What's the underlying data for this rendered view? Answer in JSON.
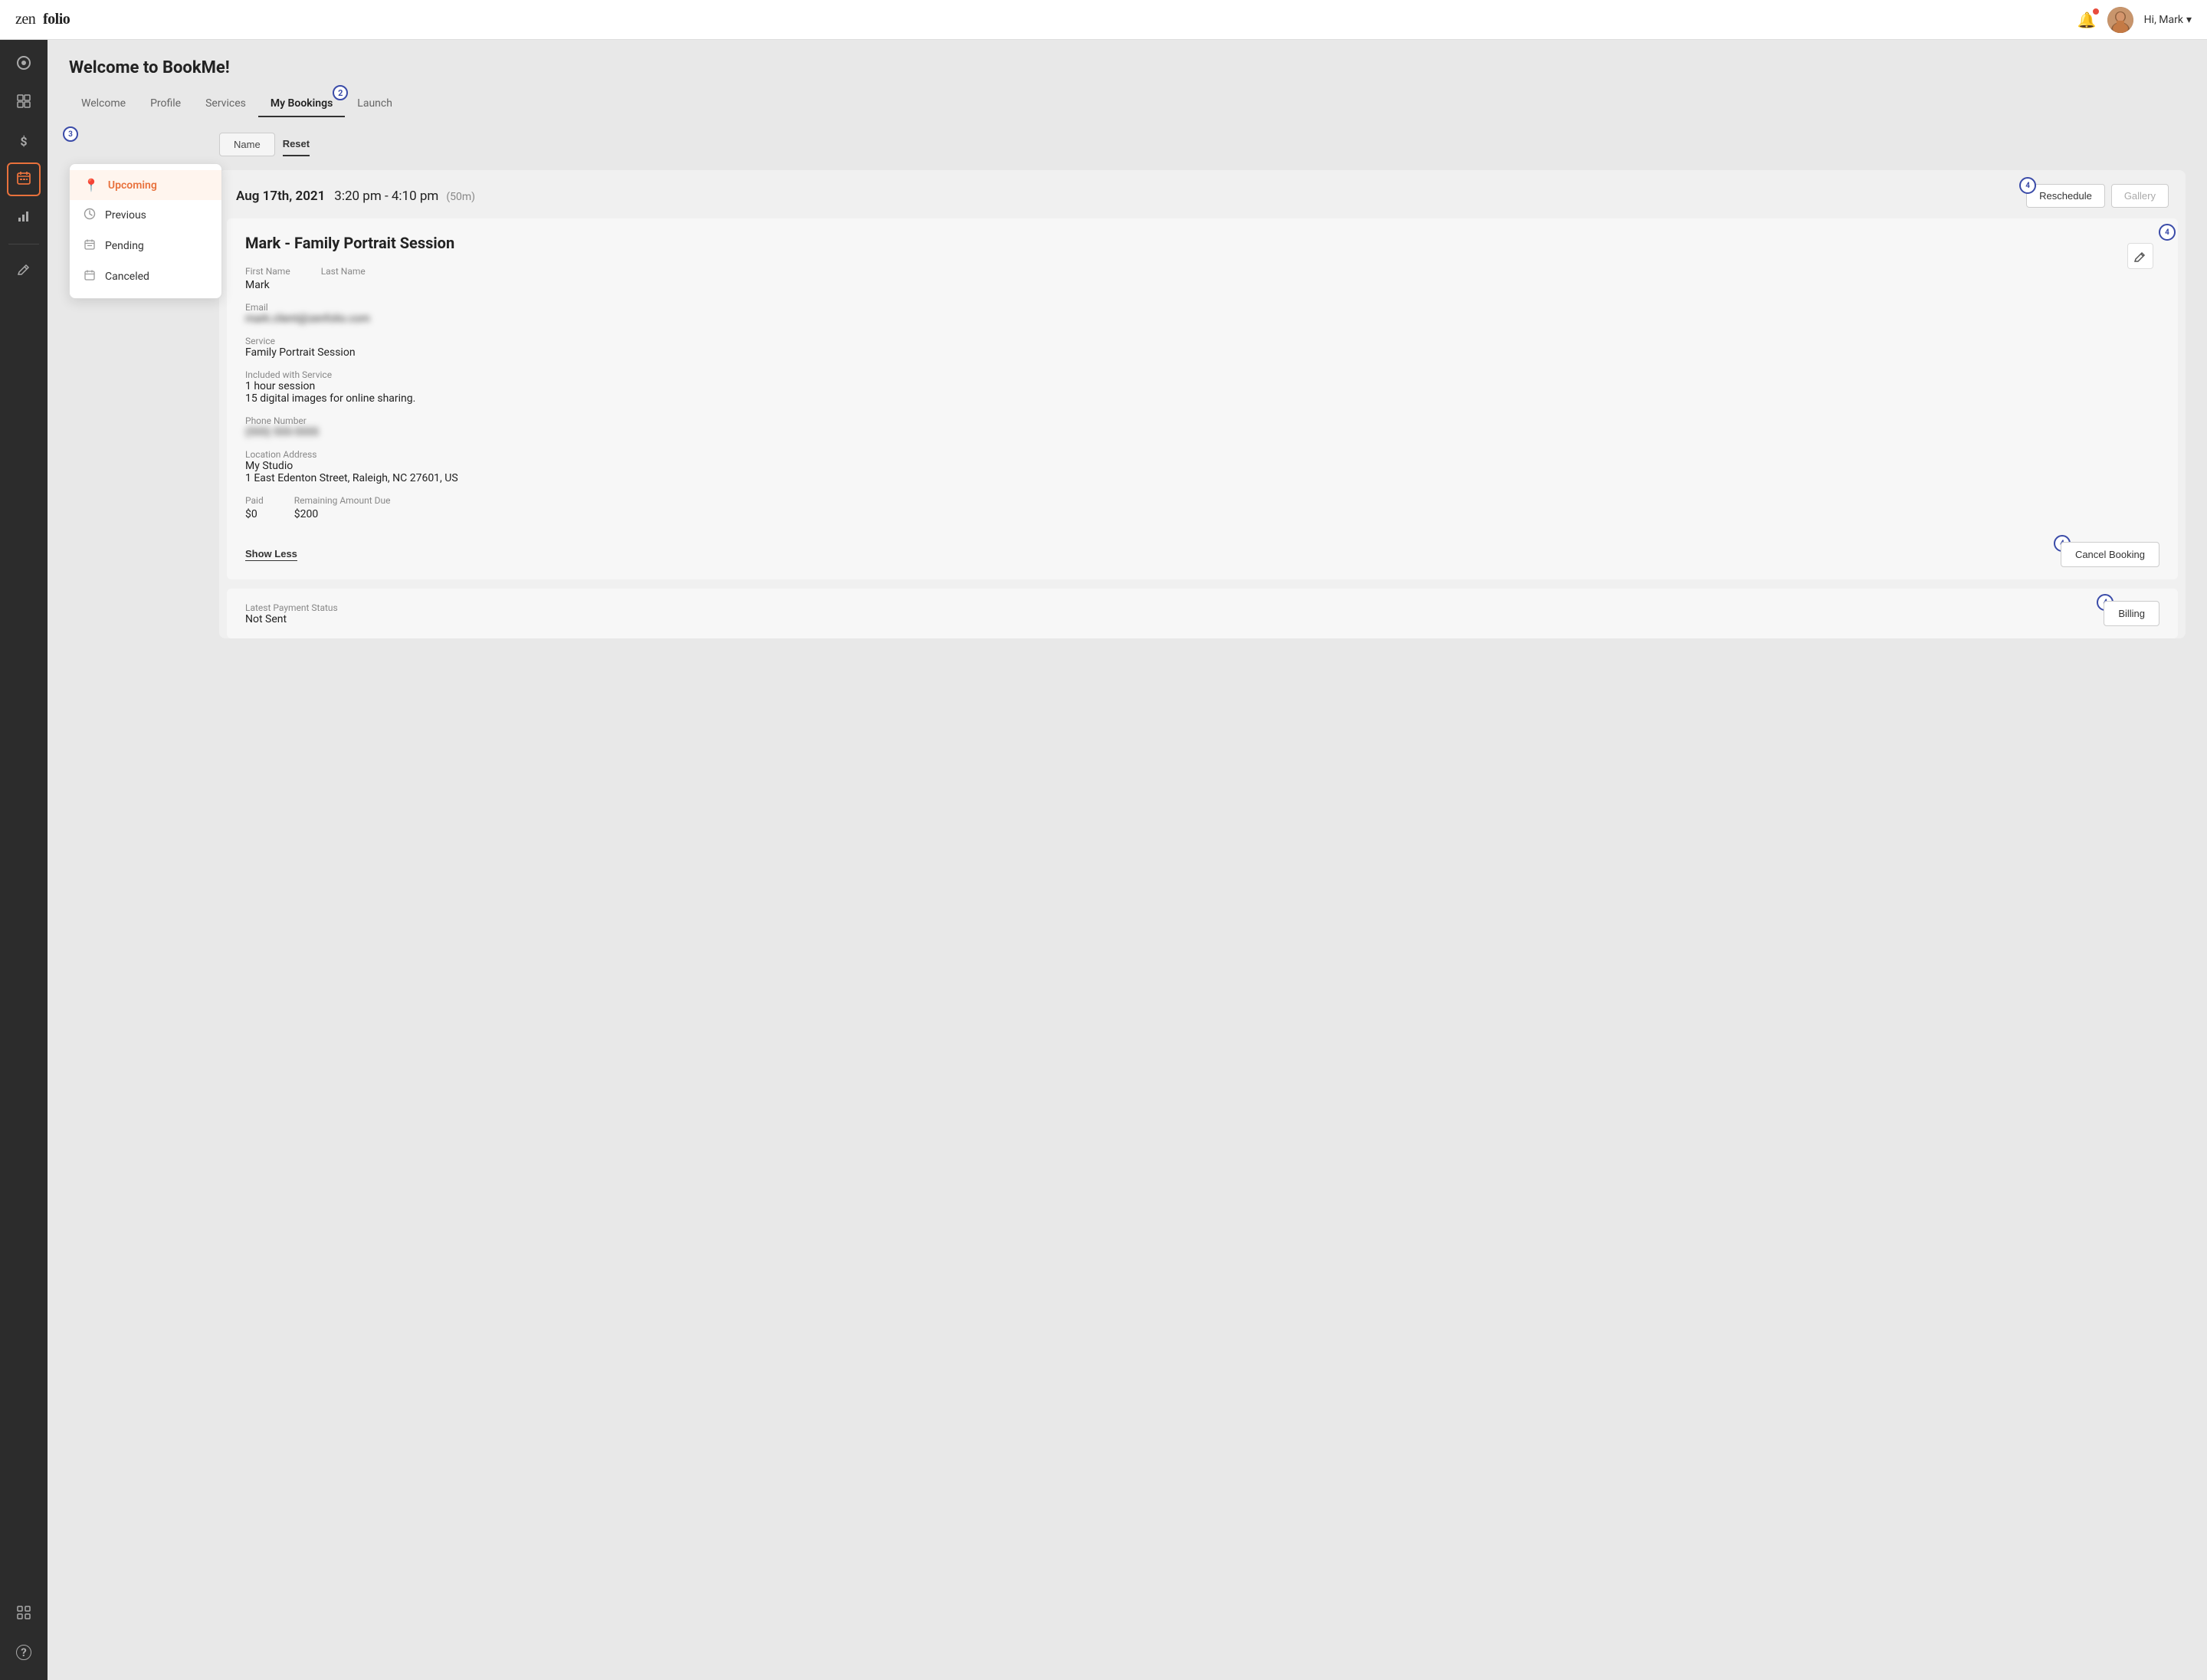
{
  "app": {
    "name": "zenfolio"
  },
  "topnav": {
    "user_greeting": "Hi, Mark",
    "chevron": "▾"
  },
  "sidebar": {
    "items": [
      {
        "id": "dashboard",
        "icon": "⊙",
        "label": "Dashboard"
      },
      {
        "id": "gallery",
        "icon": "⬜",
        "label": "Gallery"
      },
      {
        "id": "dollar",
        "icon": "$",
        "label": "Sales"
      },
      {
        "id": "bookings",
        "icon": "📅",
        "label": "Bookings",
        "active": true
      },
      {
        "id": "chart",
        "icon": "📊",
        "label": "Analytics"
      },
      {
        "id": "edit",
        "icon": "✏",
        "label": "Edit"
      }
    ],
    "bottom_items": [
      {
        "id": "apps",
        "icon": "⊞",
        "label": "Apps"
      },
      {
        "id": "help",
        "icon": "?",
        "label": "Help"
      }
    ]
  },
  "page": {
    "title": "Welcome to BookMe!",
    "tabs": [
      {
        "id": "welcome",
        "label": "Welcome"
      },
      {
        "id": "profile",
        "label": "Profile"
      },
      {
        "id": "services",
        "label": "Services"
      },
      {
        "id": "my-bookings",
        "label": "My Bookings",
        "active": true,
        "badge": "2"
      },
      {
        "id": "launch",
        "label": "Launch"
      }
    ]
  },
  "bookings_filter": {
    "name_btn": "Name",
    "reset_btn": "Reset"
  },
  "booking_categories": [
    {
      "id": "upcoming",
      "label": "Upcoming",
      "icon": "📍",
      "active": true
    },
    {
      "id": "previous",
      "label": "Previous",
      "icon": "🕐"
    },
    {
      "id": "pending",
      "label": "Pending",
      "icon": "📋"
    },
    {
      "id": "canceled",
      "label": "Canceled",
      "icon": "📅"
    }
  ],
  "dropdown_badge": "3",
  "booking": {
    "date": "Aug 17th, 2021",
    "time": "3:20 pm - 4:10 pm",
    "duration": "(50m)",
    "reschedule_label": "Reschedule",
    "gallery_label": "Gallery",
    "reschedule_badge": "4",
    "name": "Mark    - Family Portrait Session",
    "edit_badge": "4",
    "fields": {
      "first_name_label": "First Name",
      "first_name_value": "Mark",
      "last_name_label": "Last Name",
      "last_name_value": "",
      "email_label": "Email",
      "email_value": "mark.client@zenfolio.com",
      "service_label": "Service",
      "service_value": "Family Portrait Session",
      "included_label": "Included with Service",
      "included_line1": "1 hour session",
      "included_line2": "15 digital images for online sharing.",
      "phone_label": "Phone Number",
      "phone_value": "(555) 555-5555",
      "location_label": "Location Address",
      "location_name": "My Studio",
      "location_address": "1 East Edenton Street, Raleigh, NC 27601, US",
      "paid_label": "Paid",
      "paid_value": "$0",
      "remaining_label": "Remaining Amount Due",
      "remaining_value": "$200"
    },
    "show_less_label": "Show Less",
    "cancel_booking_label": "Cancel Booking",
    "cancel_badge": "4",
    "payment_status_label": "Latest Payment Status",
    "payment_status_value": "Not Sent",
    "billing_label": "Billing",
    "billing_badge": "4"
  }
}
